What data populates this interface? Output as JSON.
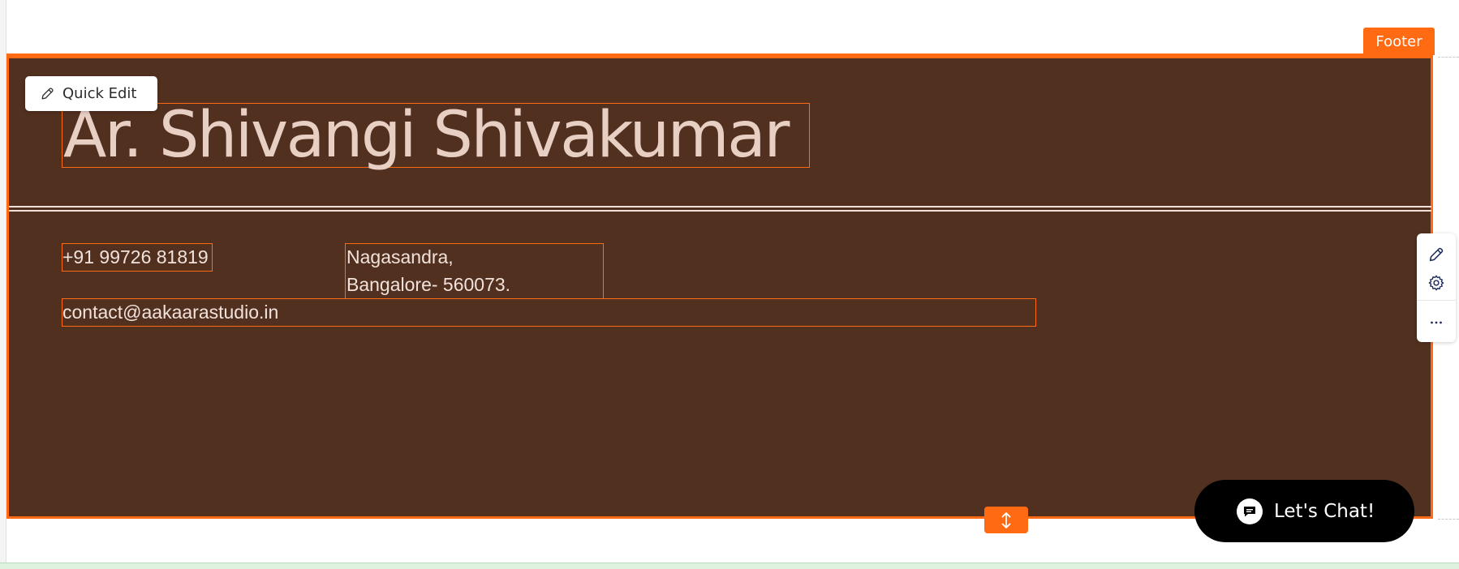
{
  "section_tag": "Footer",
  "quick_edit": {
    "label": "Quick Edit"
  },
  "title": "Ar. Shivangi Shivakumar",
  "contact": {
    "phone": "+91 99726 81819",
    "address_line1": "Nagasandra,",
    "address_line2": "Bangalore- 560073.",
    "email": "contact@aakaarastudio.in"
  },
  "chat": {
    "label": "Let's Chat!"
  },
  "colors": {
    "footer_background": "#52301f",
    "selection_accent": "#ff6a13",
    "title_text": "#e8cfc4",
    "body_text": "#f1e2db"
  },
  "icons": {
    "quick_edit": "pencil-icon",
    "side_panel": [
      "pencil-icon",
      "gear-icon",
      "more-icon"
    ],
    "resize": "vertical-resize-icon",
    "chat": "chat-bubble-icon"
  }
}
